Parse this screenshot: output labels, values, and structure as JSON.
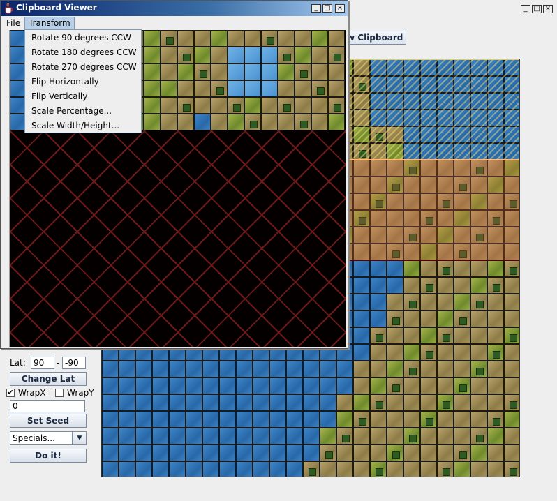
{
  "main_window": {
    "view_clipboard_button": "w Clipboard",
    "controls": {
      "lat_label": "Lat:",
      "lat_from": "90",
      "lat_separator": "-",
      "lat_to": "-90",
      "change_lat_button": "Change Lat",
      "wrap_x_label": "WrapX",
      "wrap_x_checked": true,
      "wrap_y_label": "WrapY",
      "wrap_y_checked": false,
      "seed_value": "0",
      "set_seed_button": "Set Seed",
      "specials_select": "Specials...",
      "do_it_button": "Do it!"
    },
    "title_buttons": [
      "_",
      "□",
      "×"
    ]
  },
  "clipboard_viewer": {
    "title": "Clipboard Viewer",
    "title_buttons": [
      "_",
      "□",
      "×"
    ],
    "menus": [
      "File",
      "Transform"
    ],
    "active_menu": "Transform",
    "transform_items": [
      "Rotate 90 degrees CCW",
      "Rotate 180 degrees CCW",
      "Rotate 270 degrees CCW",
      "Flip Horizontally",
      "Flip Vertically",
      "Scale Percentage...",
      "Scale Width/Height..."
    ]
  },
  "colors": {
    "water": "#2f75b8",
    "desert": "#a8955c",
    "grassland": "#8ea23d",
    "title_bar": "#0a246a",
    "selection_yellow": "#e6d24a",
    "selection_red": "#e05050"
  }
}
